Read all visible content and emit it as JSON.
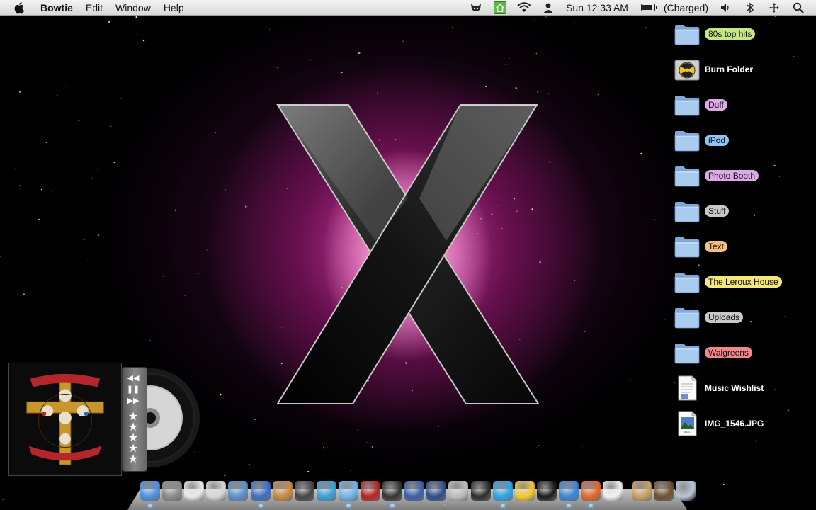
{
  "menubar": {
    "app_name": "Bowtie",
    "menus": [
      "Edit",
      "Window",
      "Help"
    ],
    "clock": "Sun 12:33 AM",
    "battery_status": "(Charged)",
    "battery_level": 1.0,
    "status_icons": [
      "cat-icon",
      "home-icon",
      "wifi-icon",
      "user-icon",
      "battery-icon",
      "volume-icon",
      "bluetooth-icon",
      "spotlight-search-icon"
    ]
  },
  "desktop": {
    "icons": [
      {
        "label": "80s top hits",
        "type": "folder",
        "tag_color": "#c5e884"
      },
      {
        "label": "Burn Folder",
        "type": "burn-folder",
        "tag_color": null
      },
      {
        "label": "Duff",
        "type": "folder",
        "tag_color": "#dcaae6"
      },
      {
        "label": "iPod",
        "type": "folder",
        "tag_color": "#8fc3f5"
      },
      {
        "label": "Photo Booth",
        "type": "folder",
        "tag_color": "#dcaae6"
      },
      {
        "label": "Stuff",
        "type": "folder",
        "tag_color": "#c8c8c8"
      },
      {
        "label": "Text",
        "type": "folder",
        "tag_color": "#f9c07a"
      },
      {
        "label": "The Leroux House",
        "type": "folder",
        "tag_color": "#f6e776"
      },
      {
        "label": "Uploads",
        "type": "folder",
        "tag_color": "#c8c8c8"
      },
      {
        "label": "Walgreens",
        "type": "folder",
        "tag_color": "#f4878a"
      },
      {
        "label": "Music Wishlist",
        "type": "document",
        "tag_color": null
      },
      {
        "label": "IMG_1546.JPG",
        "type": "jpeg",
        "tag_color": null
      }
    ]
  },
  "bowtie": {
    "rating_stars": 5,
    "controls": [
      "previous-track-icon",
      "pause-icon",
      "next-track-icon"
    ]
  },
  "dock": {
    "items": [
      {
        "name": "finder",
        "color": "#4a8fe0"
      },
      {
        "name": "system-preferences",
        "color": "#8a8a8a"
      },
      {
        "name": "ical",
        "color": "#e8e8e8"
      },
      {
        "name": "textedit",
        "color": "#d8d8d8"
      },
      {
        "name": "mail",
        "color": "#5b8fc9"
      },
      {
        "name": "address-book",
        "color": "#3b6ec4"
      },
      {
        "name": "iphoto",
        "color": "#c98a3a"
      },
      {
        "name": "stars-app",
        "color": "#444444"
      },
      {
        "name": "network-app",
        "color": "#3aa0d8"
      },
      {
        "name": "itunes",
        "color": "#6fb3ee"
      },
      {
        "name": "photo-booth",
        "color": "#b82020"
      },
      {
        "name": "imovie",
        "color": "#333333"
      },
      {
        "name": "spaces",
        "color": "#3a5ea8"
      },
      {
        "name": "google-earth",
        "color": "#2a4c8a"
      },
      {
        "name": "calculator",
        "color": "#bdbdbd"
      },
      {
        "name": "adium-character",
        "color": "#2b2b2b"
      },
      {
        "name": "skype",
        "color": "#2aa5e8"
      },
      {
        "name": "adium-duck",
        "color": "#f2c830"
      },
      {
        "name": "front-row",
        "color": "#1a1a1a"
      },
      {
        "name": "safari",
        "color": "#3a86d8"
      },
      {
        "name": "firefox",
        "color": "#e0662a"
      },
      {
        "name": "picasa",
        "color": "#f0f0f0"
      },
      {
        "name": "applications-folder",
        "color": "#c8a060"
      },
      {
        "name": "downloads-folder",
        "color": "#6a5030"
      },
      {
        "name": "trash",
        "color": "#b8c8d8"
      }
    ]
  }
}
